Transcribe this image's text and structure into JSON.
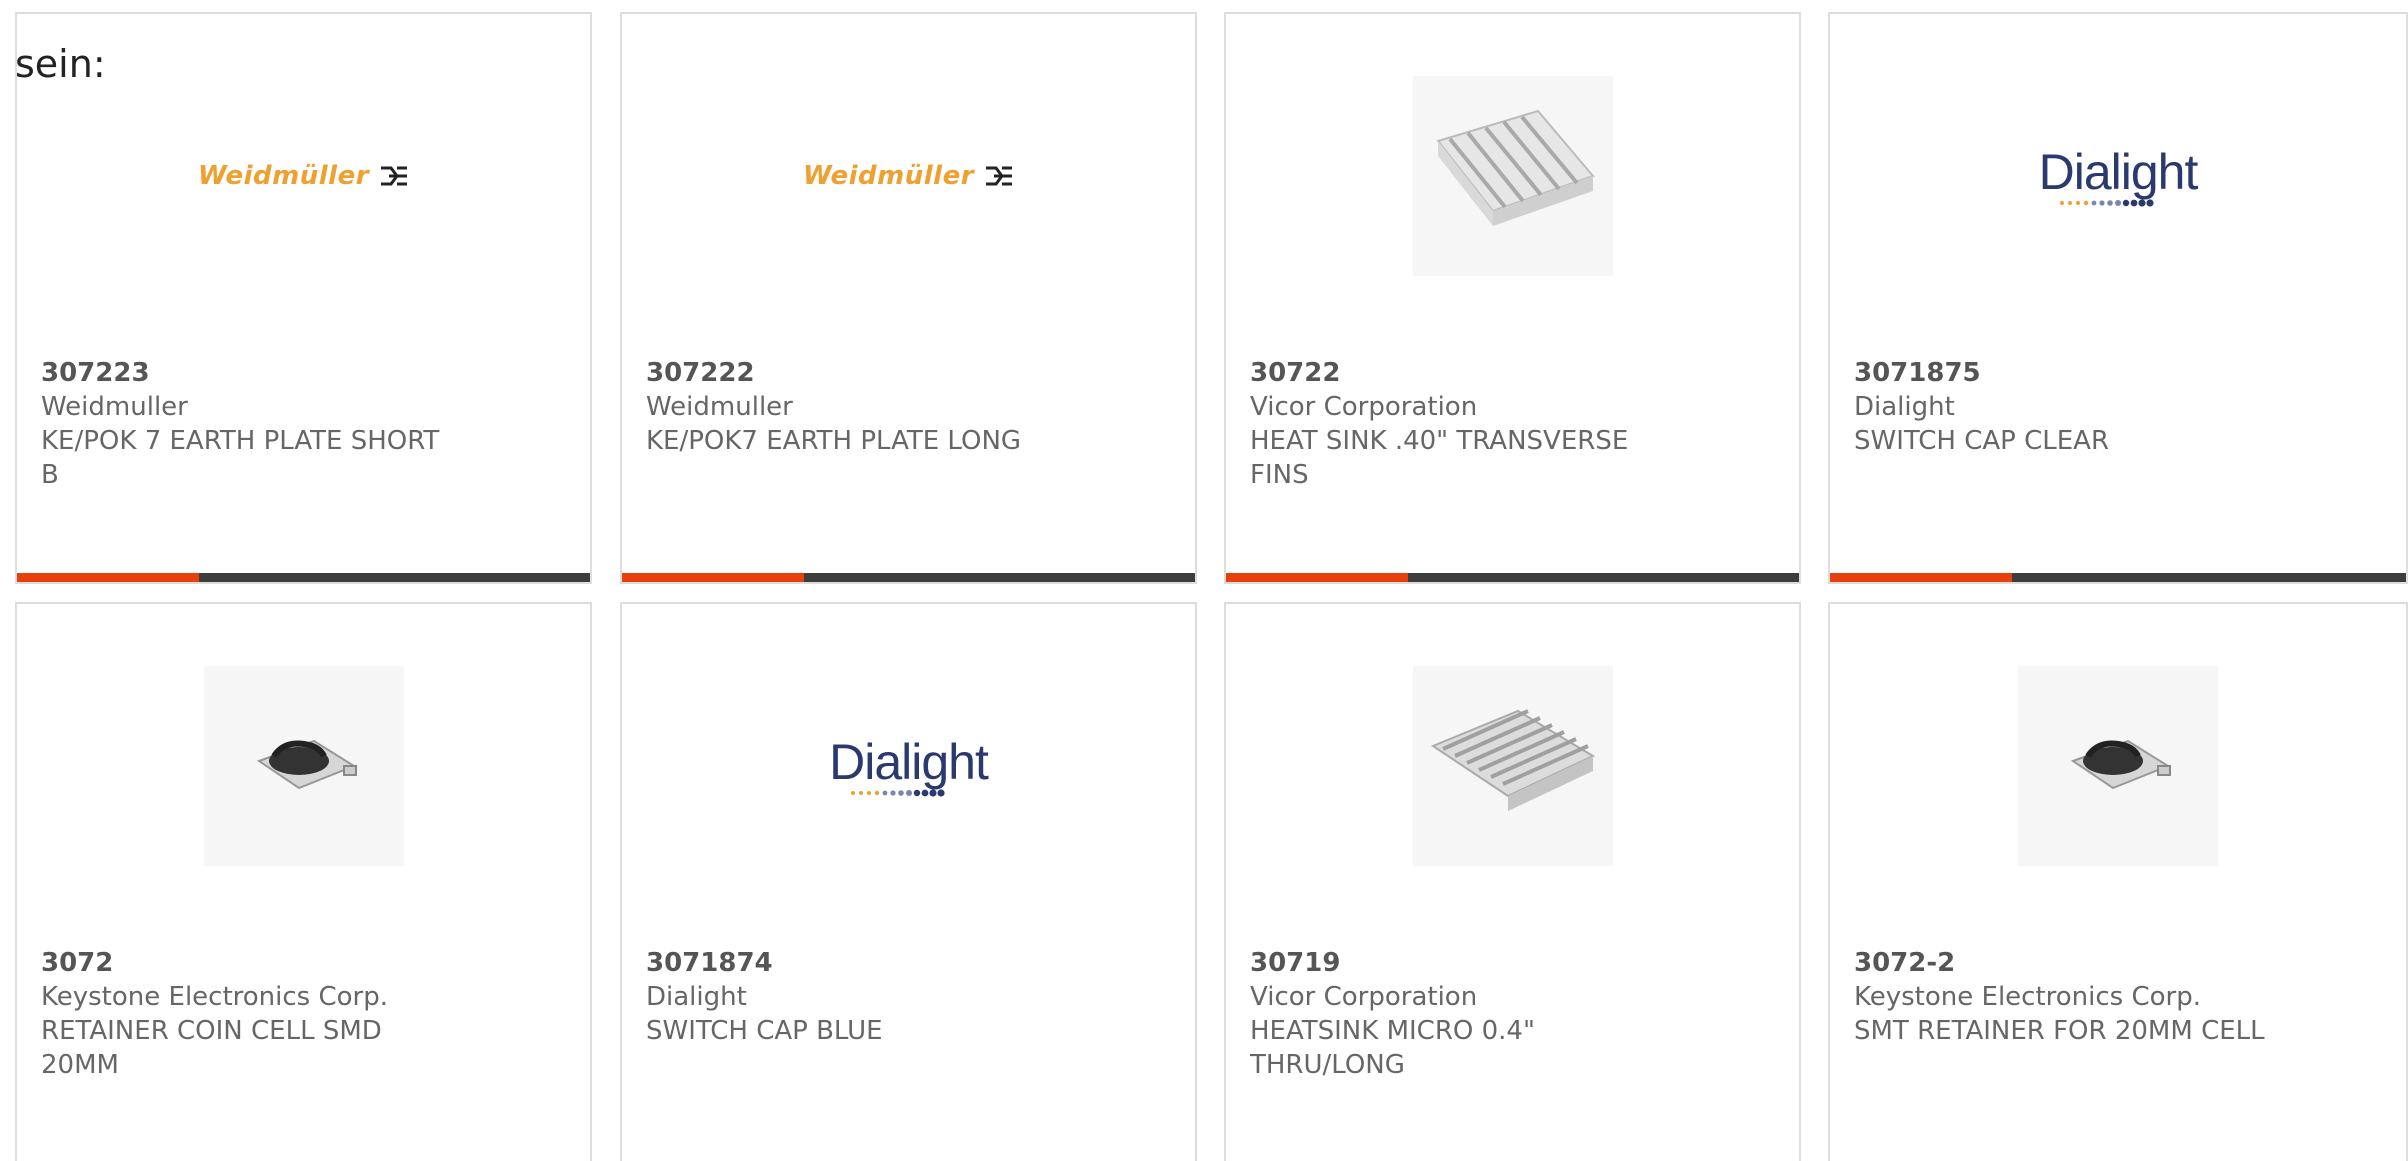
{
  "intro_text": "sein:",
  "colors": {
    "accent": "#e8400c",
    "bar": "#3d3d3d",
    "weidmuller": "#f0a030",
    "dialight": "#2a3a6e"
  },
  "products": [
    {
      "part_number": "307223",
      "manufacturer": "Weidmuller",
      "description": "KE/POK 7 EARTH PLATE SHORT B",
      "image": "weidmuller-logo",
      "logo_text": "Weidmüller"
    },
    {
      "part_number": "307222",
      "manufacturer": "Weidmuller",
      "description": "KE/POK7 EARTH PLATE LONG",
      "image": "weidmuller-logo",
      "logo_text": "Weidmüller"
    },
    {
      "part_number": "30722",
      "manufacturer": "Vicor Corporation",
      "description": "HEAT SINK .40\" TRANSVERSE FINS",
      "image": "heatsink-transverse-photo"
    },
    {
      "part_number": "3071875",
      "manufacturer": "Dialight",
      "description": "SWITCH CAP CLEAR",
      "image": "dialight-logo",
      "logo_text": "Dialight"
    },
    {
      "part_number": "3072",
      "manufacturer": "Keystone Electronics Corp.",
      "description": "RETAINER COIN CELL SMD 20MM",
      "image": "coin-cell-retainer-photo"
    },
    {
      "part_number": "3071874",
      "manufacturer": "Dialight",
      "description": "SWITCH CAP BLUE",
      "image": "dialight-logo",
      "logo_text": "Dialight"
    },
    {
      "part_number": "30719",
      "manufacturer": "Vicor Corporation",
      "description": "HEATSINK MICRO 0.4\" THRU/LONG",
      "image": "heatsink-micro-photo"
    },
    {
      "part_number": "3072-2",
      "manufacturer": "Keystone Electronics Corp.",
      "description": "SMT RETAINER FOR 20MM CELL",
      "image": "coin-cell-retainer-photo"
    }
  ]
}
